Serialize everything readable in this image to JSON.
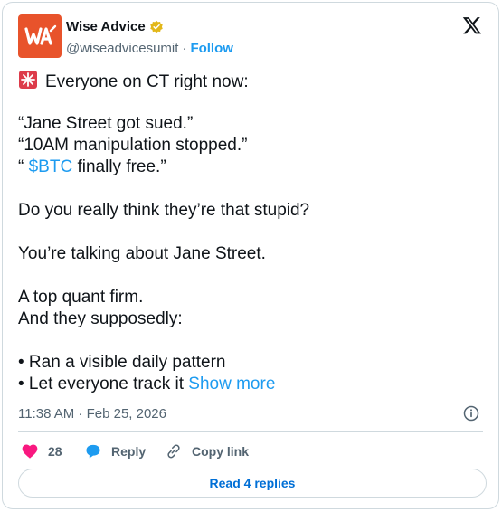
{
  "header": {
    "name": "Wise Advice",
    "handle": "@wiseadvicesumit",
    "separator": "·",
    "follow_label": "Follow",
    "avatar_text": "WA"
  },
  "tweet": {
    "lines": [
      "Everyone on CT right now:",
      "",
      "“Jane Street got sued.”",
      "“10AM manipulation stopped.”",
      "",
      "",
      "Do you really think they’re that stupid?",
      "",
      "You’re talking about Jane Street.",
      "",
      "A top quant firm.",
      "And they supposedly:",
      "",
      "• Ran a visible daily pattern",
      "• Let everyone track it"
    ],
    "btc_prefix": "“ ",
    "cashtag": "$BTC",
    "btc_suffix": " finally free.”",
    "show_more": "Show more",
    "timestamp": "11:38 AM · Feb 25, 2026"
  },
  "actions": {
    "like_count": "28",
    "reply_label": "Reply",
    "copy_link_label": "Copy link"
  },
  "read_replies_label": "Read 4 replies",
  "colors": {
    "accent": "#1d9bf0",
    "like": "#f91880",
    "avatar_bg": "#e8532b",
    "verified": "#e2b719"
  }
}
